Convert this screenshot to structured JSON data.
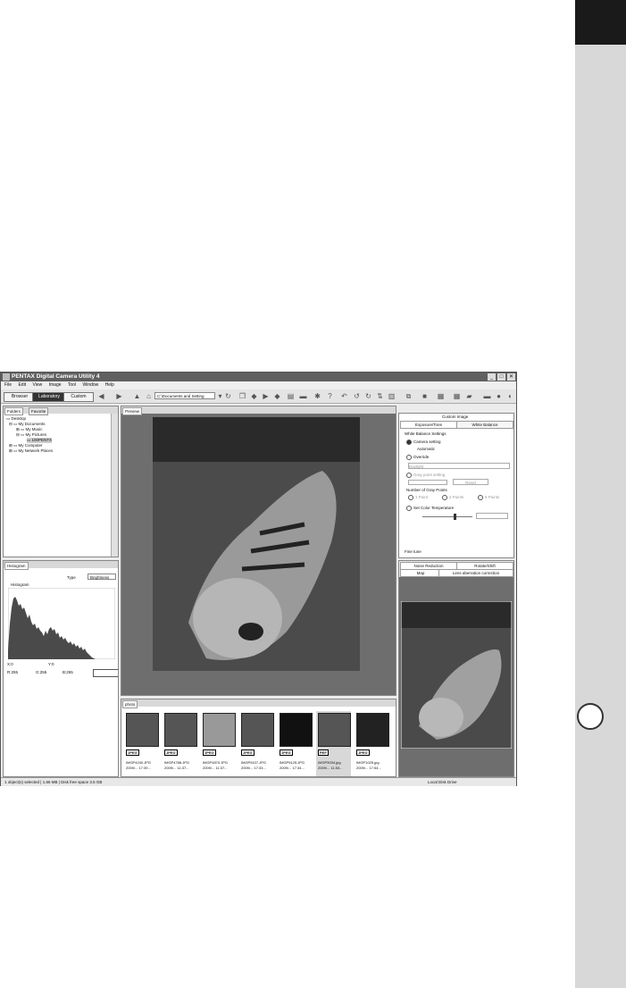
{
  "window": {
    "title": "PENTAX Digital Camera Utility 4",
    "controls": [
      "_",
      "□",
      "✕"
    ]
  },
  "menu": [
    "File",
    "Edit",
    "View",
    "Image",
    "Tool",
    "Window",
    "Help"
  ],
  "toolbar": {
    "modes": [
      "Browser",
      "Laboratory",
      "Custom"
    ],
    "active_mode": "Laboratory",
    "path": "C:\\Documents and Setting"
  },
  "folders_panel": {
    "tabs": [
      "Folders",
      "Favorite"
    ],
    "tree": [
      "Desktop",
      "My Documents",
      "My Music",
      "My Pictures",
      "100PENTX",
      "My Computer",
      "My Network Places"
    ]
  },
  "histogram_panel": {
    "tab": "Histogram",
    "type_label": "Type",
    "type_value": "Brightness",
    "chart_title": "Histogram",
    "x_readout": "X:0",
    "y_readout": "Y:0",
    "r_readout": "R:255",
    "g_readout": "G:255",
    "b_readout": "B:255"
  },
  "preview_panel": {
    "tab": "Preview"
  },
  "browser_strip": {
    "tab": "photo",
    "thumbs": [
      {
        "badge": "JPEG",
        "name": "IMGP4240.JPG",
        "date": "2009/... 17:39..."
      },
      {
        "badge": "JPEG",
        "name": "IMGP4788.JPG",
        "date": "2009/... 11:37..."
      },
      {
        "badge": "JPEG",
        "name": "IMGP4870.JPG",
        "date": "2009/... 11:37..."
      },
      {
        "badge": "JPEG",
        "name": "IMGP5107.JPG",
        "date": "2009/... 17:33..."
      },
      {
        "badge": "JPEG",
        "name": "IMGP5125.JPG",
        "date": "2009/... 17:34..."
      },
      {
        "badge": "PEF",
        "name": "IMGP5034.jpg",
        "date": "2009/... 11:53..."
      },
      {
        "badge": "JPEG",
        "name": "IMGP1025.jpg",
        "date": "2009/... 17:54..."
      }
    ]
  },
  "custom_image_panel": {
    "header": "Custom Image",
    "tabs": [
      "Exposure/Tone",
      "White Balance"
    ],
    "active_tab": "White Balance",
    "section_title": "White Balance Settings",
    "camera_setting": "Camera setting",
    "automatic": "Automatic",
    "override": "Override",
    "override_value": "Daylight",
    "gray_point": "Gray point setting",
    "reset": "Reset",
    "num_gray_points": "Number of Gray Points",
    "points": [
      "1 Point",
      "3 Points",
      "5 Points"
    ],
    "set_color_temp": "Set Color Temperature",
    "fine_tune": "Fine tune"
  },
  "lower_right_panel": {
    "tabs_row1": [
      "Noise Reduction",
      "Rotate/Shift"
    ],
    "tabs_row2": [
      "Map",
      "Lens aberration correction"
    ]
  },
  "status_bar": {
    "left": "1 object(s) selected | 1.66 MB | Disk free space 3.5 GB",
    "right": "Local Disk Drive"
  }
}
